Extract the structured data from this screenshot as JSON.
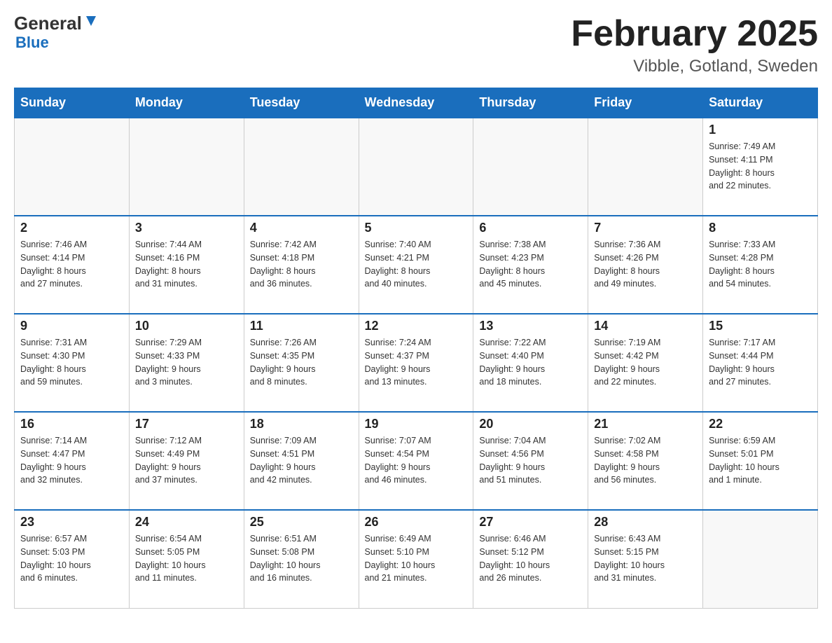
{
  "header": {
    "logo_general": "General",
    "logo_blue": "Blue",
    "title": "February 2025",
    "subtitle": "Vibble, Gotland, Sweden"
  },
  "weekdays": [
    "Sunday",
    "Monday",
    "Tuesday",
    "Wednesday",
    "Thursday",
    "Friday",
    "Saturday"
  ],
  "weeks": [
    [
      {
        "day": "",
        "info": ""
      },
      {
        "day": "",
        "info": ""
      },
      {
        "day": "",
        "info": ""
      },
      {
        "day": "",
        "info": ""
      },
      {
        "day": "",
        "info": ""
      },
      {
        "day": "",
        "info": ""
      },
      {
        "day": "1",
        "info": "Sunrise: 7:49 AM\nSunset: 4:11 PM\nDaylight: 8 hours\nand 22 minutes."
      }
    ],
    [
      {
        "day": "2",
        "info": "Sunrise: 7:46 AM\nSunset: 4:14 PM\nDaylight: 8 hours\nand 27 minutes."
      },
      {
        "day": "3",
        "info": "Sunrise: 7:44 AM\nSunset: 4:16 PM\nDaylight: 8 hours\nand 31 minutes."
      },
      {
        "day": "4",
        "info": "Sunrise: 7:42 AM\nSunset: 4:18 PM\nDaylight: 8 hours\nand 36 minutes."
      },
      {
        "day": "5",
        "info": "Sunrise: 7:40 AM\nSunset: 4:21 PM\nDaylight: 8 hours\nand 40 minutes."
      },
      {
        "day": "6",
        "info": "Sunrise: 7:38 AM\nSunset: 4:23 PM\nDaylight: 8 hours\nand 45 minutes."
      },
      {
        "day": "7",
        "info": "Sunrise: 7:36 AM\nSunset: 4:26 PM\nDaylight: 8 hours\nand 49 minutes."
      },
      {
        "day": "8",
        "info": "Sunrise: 7:33 AM\nSunset: 4:28 PM\nDaylight: 8 hours\nand 54 minutes."
      }
    ],
    [
      {
        "day": "9",
        "info": "Sunrise: 7:31 AM\nSunset: 4:30 PM\nDaylight: 8 hours\nand 59 minutes."
      },
      {
        "day": "10",
        "info": "Sunrise: 7:29 AM\nSunset: 4:33 PM\nDaylight: 9 hours\nand 3 minutes."
      },
      {
        "day": "11",
        "info": "Sunrise: 7:26 AM\nSunset: 4:35 PM\nDaylight: 9 hours\nand 8 minutes."
      },
      {
        "day": "12",
        "info": "Sunrise: 7:24 AM\nSunset: 4:37 PM\nDaylight: 9 hours\nand 13 minutes."
      },
      {
        "day": "13",
        "info": "Sunrise: 7:22 AM\nSunset: 4:40 PM\nDaylight: 9 hours\nand 18 minutes."
      },
      {
        "day": "14",
        "info": "Sunrise: 7:19 AM\nSunset: 4:42 PM\nDaylight: 9 hours\nand 22 minutes."
      },
      {
        "day": "15",
        "info": "Sunrise: 7:17 AM\nSunset: 4:44 PM\nDaylight: 9 hours\nand 27 minutes."
      }
    ],
    [
      {
        "day": "16",
        "info": "Sunrise: 7:14 AM\nSunset: 4:47 PM\nDaylight: 9 hours\nand 32 minutes."
      },
      {
        "day": "17",
        "info": "Sunrise: 7:12 AM\nSunset: 4:49 PM\nDaylight: 9 hours\nand 37 minutes."
      },
      {
        "day": "18",
        "info": "Sunrise: 7:09 AM\nSunset: 4:51 PM\nDaylight: 9 hours\nand 42 minutes."
      },
      {
        "day": "19",
        "info": "Sunrise: 7:07 AM\nSunset: 4:54 PM\nDaylight: 9 hours\nand 46 minutes."
      },
      {
        "day": "20",
        "info": "Sunrise: 7:04 AM\nSunset: 4:56 PM\nDaylight: 9 hours\nand 51 minutes."
      },
      {
        "day": "21",
        "info": "Sunrise: 7:02 AM\nSunset: 4:58 PM\nDaylight: 9 hours\nand 56 minutes."
      },
      {
        "day": "22",
        "info": "Sunrise: 6:59 AM\nSunset: 5:01 PM\nDaylight: 10 hours\nand 1 minute."
      }
    ],
    [
      {
        "day": "23",
        "info": "Sunrise: 6:57 AM\nSunset: 5:03 PM\nDaylight: 10 hours\nand 6 minutes."
      },
      {
        "day": "24",
        "info": "Sunrise: 6:54 AM\nSunset: 5:05 PM\nDaylight: 10 hours\nand 11 minutes."
      },
      {
        "day": "25",
        "info": "Sunrise: 6:51 AM\nSunset: 5:08 PM\nDaylight: 10 hours\nand 16 minutes."
      },
      {
        "day": "26",
        "info": "Sunrise: 6:49 AM\nSunset: 5:10 PM\nDaylight: 10 hours\nand 21 minutes."
      },
      {
        "day": "27",
        "info": "Sunrise: 6:46 AM\nSunset: 5:12 PM\nDaylight: 10 hours\nand 26 minutes."
      },
      {
        "day": "28",
        "info": "Sunrise: 6:43 AM\nSunset: 5:15 PM\nDaylight: 10 hours\nand 31 minutes."
      },
      {
        "day": "",
        "info": ""
      }
    ]
  ]
}
